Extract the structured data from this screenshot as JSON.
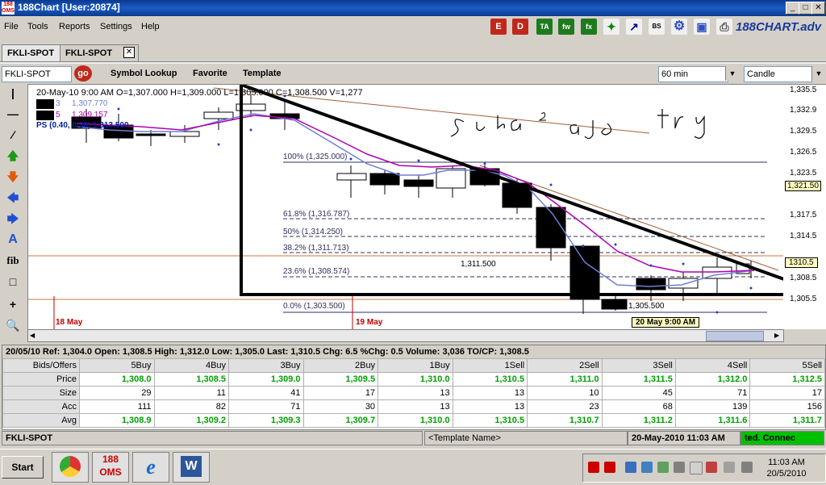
{
  "window": {
    "title": "188Chart  [User:20874]",
    "logo": "188 OMS"
  },
  "menu": [
    "File",
    "Tools",
    "Reports",
    "Settings",
    "Help"
  ],
  "toolbar_icons": [
    "E",
    "D",
    "TA",
    "fw",
    "fx",
    "scatter-icon",
    "trend-icon",
    "BS",
    "gear-icon",
    "save-icon",
    "print-icon"
  ],
  "brand": "188CHART.adv",
  "tabs": [
    "FKLI-SPOT",
    "FKLI-SPOT"
  ],
  "symbolbar": {
    "symbol": "FKLI-SPOT",
    "go": "go",
    "lookup": "Symbol Lookup",
    "favorite": "Favorite",
    "template": "Template",
    "interval": "60 min",
    "chart_type": "Candle"
  },
  "chart": {
    "header": "20-May-10  9:00 AM   O=1,307.000   H=1,309.000   L=1,305.000   C=1,308.500   V=1,277",
    "ma1_label": "3",
    "ma1_value": "1,307.770",
    "ma2_label": "5",
    "ma2_value": "1,309.157",
    "ps_label": "PS  (0.40, 0.30)  1,313.500",
    "fib": [
      "100%  (1,325.000)",
      "61.8%  (1,316.787)",
      "50%  (1,314.250)",
      "38.2%  (1,311.713)",
      "23.6%  (1,308.574)",
      "0.0%  (1,303.500)"
    ],
    "annot_high": "1,311.500",
    "annot_low": "1,305.500",
    "date1": "18 May",
    "date2": "19 May",
    "cursor_date": "20 May  9:00 AM",
    "handwriting": "suka² aje try",
    "y_ticks": [
      "1,335.5",
      "1,332.9",
      "1,329.5",
      "1,326.5",
      "1,323.5",
      "1,320.5",
      "1,317.5",
      "1,314.5",
      "1,311.5",
      "1,308.5",
      "1,305.5"
    ],
    "last_price": "1,321.50",
    "cross_price": "1310.5",
    "colors": {
      "ma1": "#6f7fd8",
      "ma2": "#b000b0",
      "fib": "#303060"
    }
  },
  "quote": {
    "header": "20/05/10    Ref: 1,304.0    Open: 1,308.5    High: 1,312.0    Low: 1,305.0    Last: 1,310.5    Chg: 6.5    %Chg: 0.5    Volume: 3,036    TO/CP: 1,308.5",
    "columns": [
      "Bids/Offers",
      "5Buy",
      "4Buy",
      "3Buy",
      "2Buy",
      "1Buy",
      "1Sell",
      "2Sell",
      "3Sell",
      "4Sell",
      "5Sell"
    ],
    "rows": [
      {
        "label": "Price",
        "values": [
          "1,308.0",
          "1,308.5",
          "1,309.0",
          "1,309.5",
          "1,310.0",
          "1,310.5",
          "1,311.0",
          "1,311.5",
          "1,312.0",
          "1,312.5"
        ]
      },
      {
        "label": "Size",
        "values": [
          "29",
          "11",
          "41",
          "17",
          "13",
          "13",
          "10",
          "45",
          "71",
          "17"
        ]
      },
      {
        "label": "Acc",
        "values": [
          "111",
          "82",
          "71",
          "30",
          "13",
          "13",
          "23",
          "68",
          "139",
          "156"
        ]
      },
      {
        "label": "Avg",
        "values": [
          "1,308.9",
          "1,309.2",
          "1,309.3",
          "1,309.7",
          "1,310.0",
          "1,310.5",
          "1,310.7",
          "1,311.2",
          "1,311.6",
          "1,311.7"
        ]
      }
    ]
  },
  "status": {
    "symbol": "FKLI-SPOT",
    "template": "<Template Name>",
    "datetime": "20-May-2010  11:03 AM",
    "conn": "ted.        Connec"
  },
  "taskbar": {
    "start": "Start",
    "time": "11:03 AM",
    "date": "20/5/2010",
    "apps": [
      "chrome-icon",
      "188 OMS",
      "ie-icon",
      "word-icon"
    ]
  }
}
